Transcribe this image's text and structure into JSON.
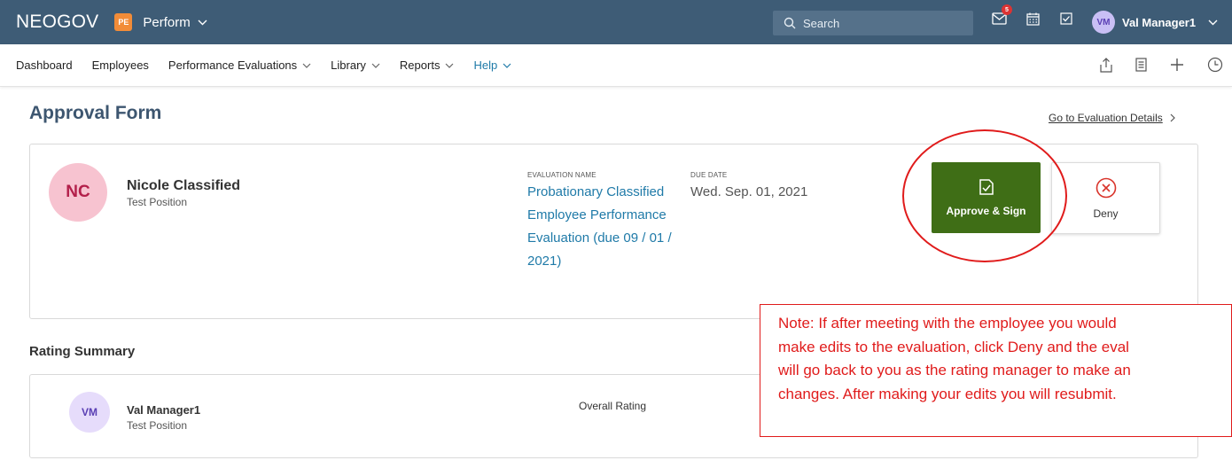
{
  "topbar": {
    "brand": "NEOGOV",
    "product_badge": "PE",
    "product_name": "Perform",
    "search_placeholder": "Search",
    "notification_count": "5",
    "user_initials": "VM",
    "user_name": "Val Manager1"
  },
  "nav": {
    "items": [
      {
        "label": "Dashboard",
        "dropdown": false
      },
      {
        "label": "Employees",
        "dropdown": false
      },
      {
        "label": "Performance Evaluations",
        "dropdown": true
      },
      {
        "label": "Library",
        "dropdown": true
      },
      {
        "label": "Reports",
        "dropdown": true
      },
      {
        "label": "Help",
        "dropdown": true
      }
    ]
  },
  "page": {
    "title": "Approval Form",
    "goto_link": "Go to Evaluation Details"
  },
  "employee": {
    "initials": "NC",
    "name": "Nicole Classified",
    "position": "Test Position",
    "eval_label": "EVALUATION NAME",
    "eval_name": "Probationary Classified Employee Performance Evaluation (due 09 / 01 / 2021)",
    "due_label": "DUE DATE",
    "due_date": "Wed. Sep. 01, 2021"
  },
  "actions": {
    "approve_label": "Approve & Sign",
    "deny_label": "Deny"
  },
  "rating_summary": {
    "title": "Rating Summary",
    "rater_initials": "VM",
    "rater_name": "Val Manager1",
    "rater_position": "Test Position",
    "overall_label": "Overall Rating"
  },
  "note": {
    "lines": [
      "Note: If after meeting with the employee you would",
      "make edits to the evaluation, click Deny and the eval",
      "will go back to you as the rating manager to make an",
      "changes. After making your edits you will resubmit."
    ]
  },
  "colors": {
    "topbar": "#3e5c76",
    "approve": "#3f6e16",
    "link": "#1f7aa8",
    "annotation": "#e01b1b"
  }
}
